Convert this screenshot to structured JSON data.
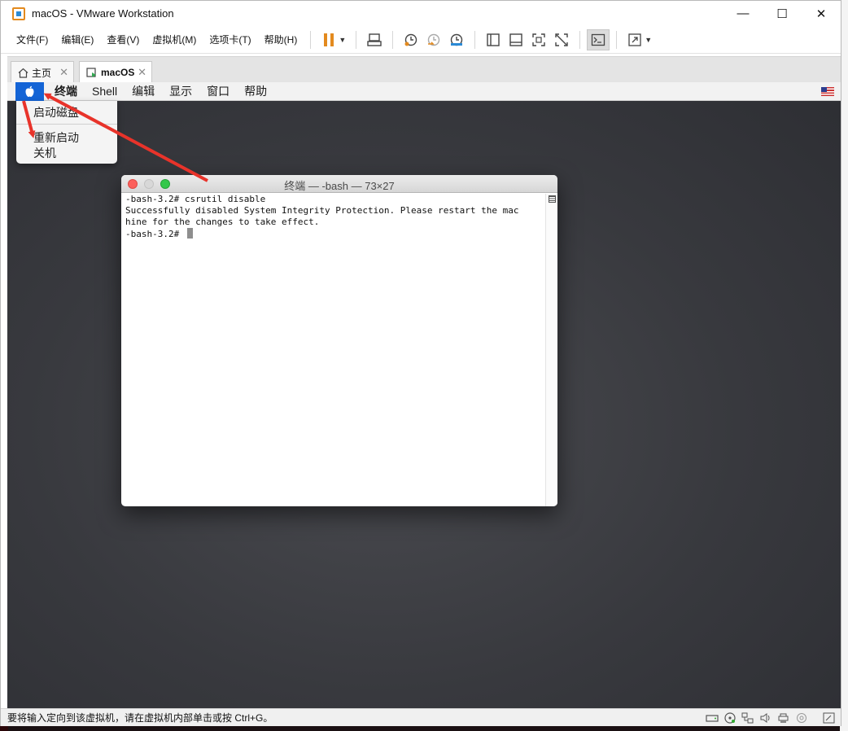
{
  "window": {
    "title": "macOS - VMware Workstation",
    "minimize_glyph": "—",
    "maximize_glyph": "☐",
    "close_glyph": "✕"
  },
  "menubar": {
    "items": [
      "文件(F)",
      "编辑(E)",
      "查看(V)",
      "虚拟机(M)",
      "选项卡(T)",
      "帮助(H)"
    ]
  },
  "toolbar": {
    "icons": [
      "pause-icon",
      "send-ctrl-alt-del-icon",
      "snapshot-take-icon",
      "snapshot-revert-icon",
      "snapshot-manager-icon",
      "library-view-icon",
      "thumbnail-view-icon",
      "fullscreen-icon",
      "unity-icon",
      "console-view-icon",
      "stretch-view-icon"
    ],
    "accent": "#e38a1e"
  },
  "tabs": [
    {
      "label": "主页",
      "active": false
    },
    {
      "label": "macOS",
      "active": true
    }
  ],
  "mac": {
    "menus": [
      "终端",
      "Shell",
      "编辑",
      "显示",
      "窗口",
      "帮助"
    ],
    "apple_menu": [
      "启动磁盘",
      "重新启动",
      "关机"
    ],
    "apple_highlight": "#1464d6"
  },
  "terminal": {
    "title": "终端 — -bash — 73×27",
    "lines": [
      "-bash-3.2# csrutil disable",
      "Successfully disabled System Integrity Protection. Please restart the mac",
      "hine for the changes to take effect.",
      "-bash-3.2# "
    ]
  },
  "statusbar": {
    "text": "要将输入定向到该虚拟机，请在虚拟机内部单击或按 Ctrl+G。",
    "icons": [
      "hard-disk-icon",
      "cd-icon",
      "network-icon",
      "sound-icon",
      "printer-icon",
      "usb-icon",
      "message-icon"
    ]
  },
  "annotation_color": "#e8332a"
}
